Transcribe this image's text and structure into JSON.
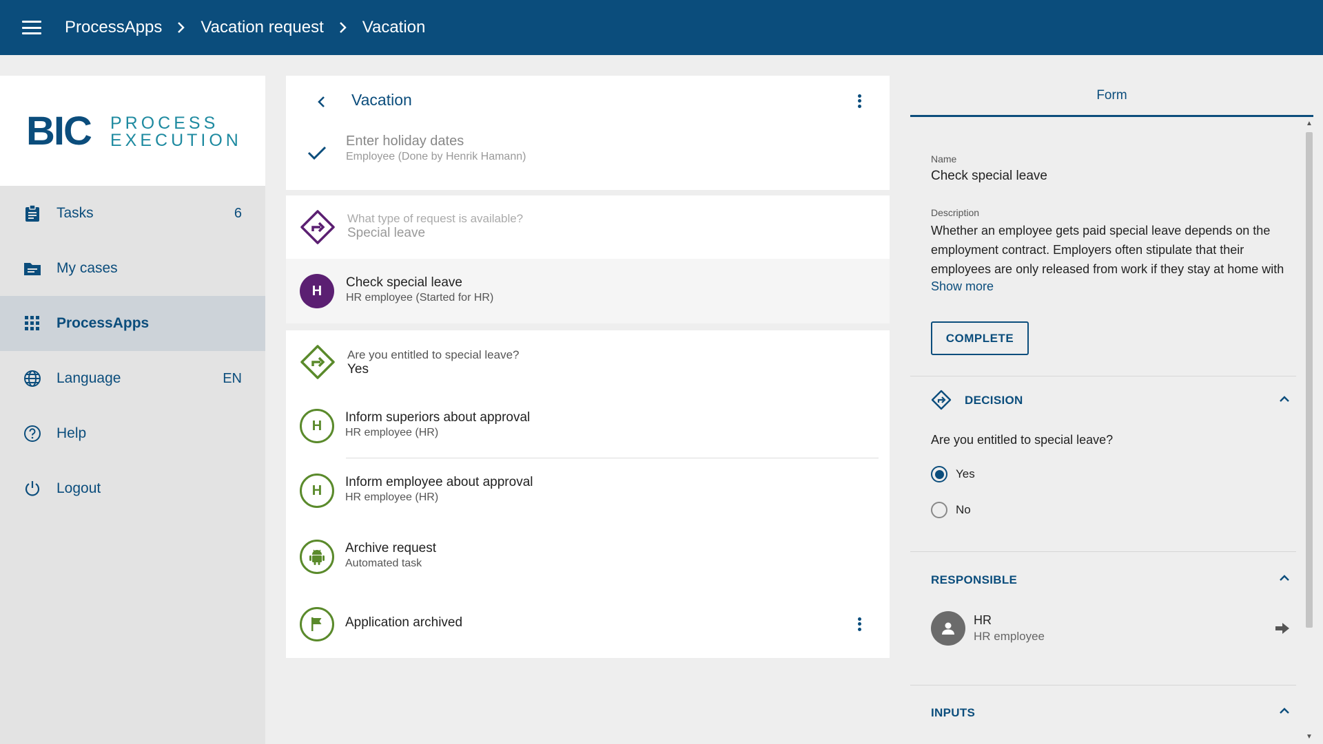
{
  "breadcrumb": [
    "ProcessApps",
    "Vacation request",
    "Vacation"
  ],
  "logo": {
    "left": "BIC",
    "right_top": "PROCESS",
    "right_bottom": "EXECUTION"
  },
  "sidebar": {
    "items": [
      {
        "label": "Tasks",
        "badge": "6",
        "icon": "clipboard-icon"
      },
      {
        "label": "My cases",
        "badge": "",
        "icon": "folder-icon"
      },
      {
        "label": "ProcessApps",
        "badge": "",
        "icon": "apps-grid-icon"
      },
      {
        "label": "Language",
        "badge": "EN",
        "icon": "globe-icon"
      },
      {
        "label": "Help",
        "badge": "",
        "icon": "help-icon"
      },
      {
        "label": "Logout",
        "badge": "",
        "icon": "power-icon"
      }
    ]
  },
  "middle": {
    "title": "Vacation",
    "steps": [
      {
        "title": "Enter holiday dates",
        "sub": "Employee (Done by Henrik Hamann)"
      },
      {
        "title": "What type of request is available?",
        "sub": "Special leave"
      },
      {
        "title": "Check special leave",
        "sub": "HR employee (Started for HR)",
        "initial": "H"
      },
      {
        "title": "Are you entitled to special leave?",
        "sub": "Yes"
      },
      {
        "title": "Inform superiors about approval",
        "sub": "HR employee (HR)",
        "initial": "H"
      },
      {
        "title": "Inform employee about approval",
        "sub": "HR employee (HR)",
        "initial": "H"
      },
      {
        "title": "Archive request",
        "sub": "Automated task"
      },
      {
        "title": "Application archived",
        "sub": ""
      }
    ]
  },
  "right": {
    "tab": "Form",
    "name_label": "Name",
    "name_value": "Check special leave",
    "desc_label": "Description",
    "desc_lines": [
      "Whether an employee gets paid special leave depends on the",
      "employment contract. Employers often stipulate that their",
      "employees are only released from work if they stay at home with"
    ],
    "show_more": "Show more",
    "complete": "COMPLETE",
    "decision": {
      "title": "DECISION",
      "question": "Are you entitled to special leave?",
      "options": [
        "Yes",
        "No"
      ],
      "selected": "Yes"
    },
    "responsible": {
      "title": "RESPONSIBLE",
      "name": "HR",
      "role": "HR employee"
    },
    "inputs": {
      "title": "INPUTS"
    }
  },
  "colors": {
    "primary": "#0b4d7c",
    "purple": "#5b1f72",
    "green": "#5a8a2b",
    "teal": "#1e8aa0"
  }
}
